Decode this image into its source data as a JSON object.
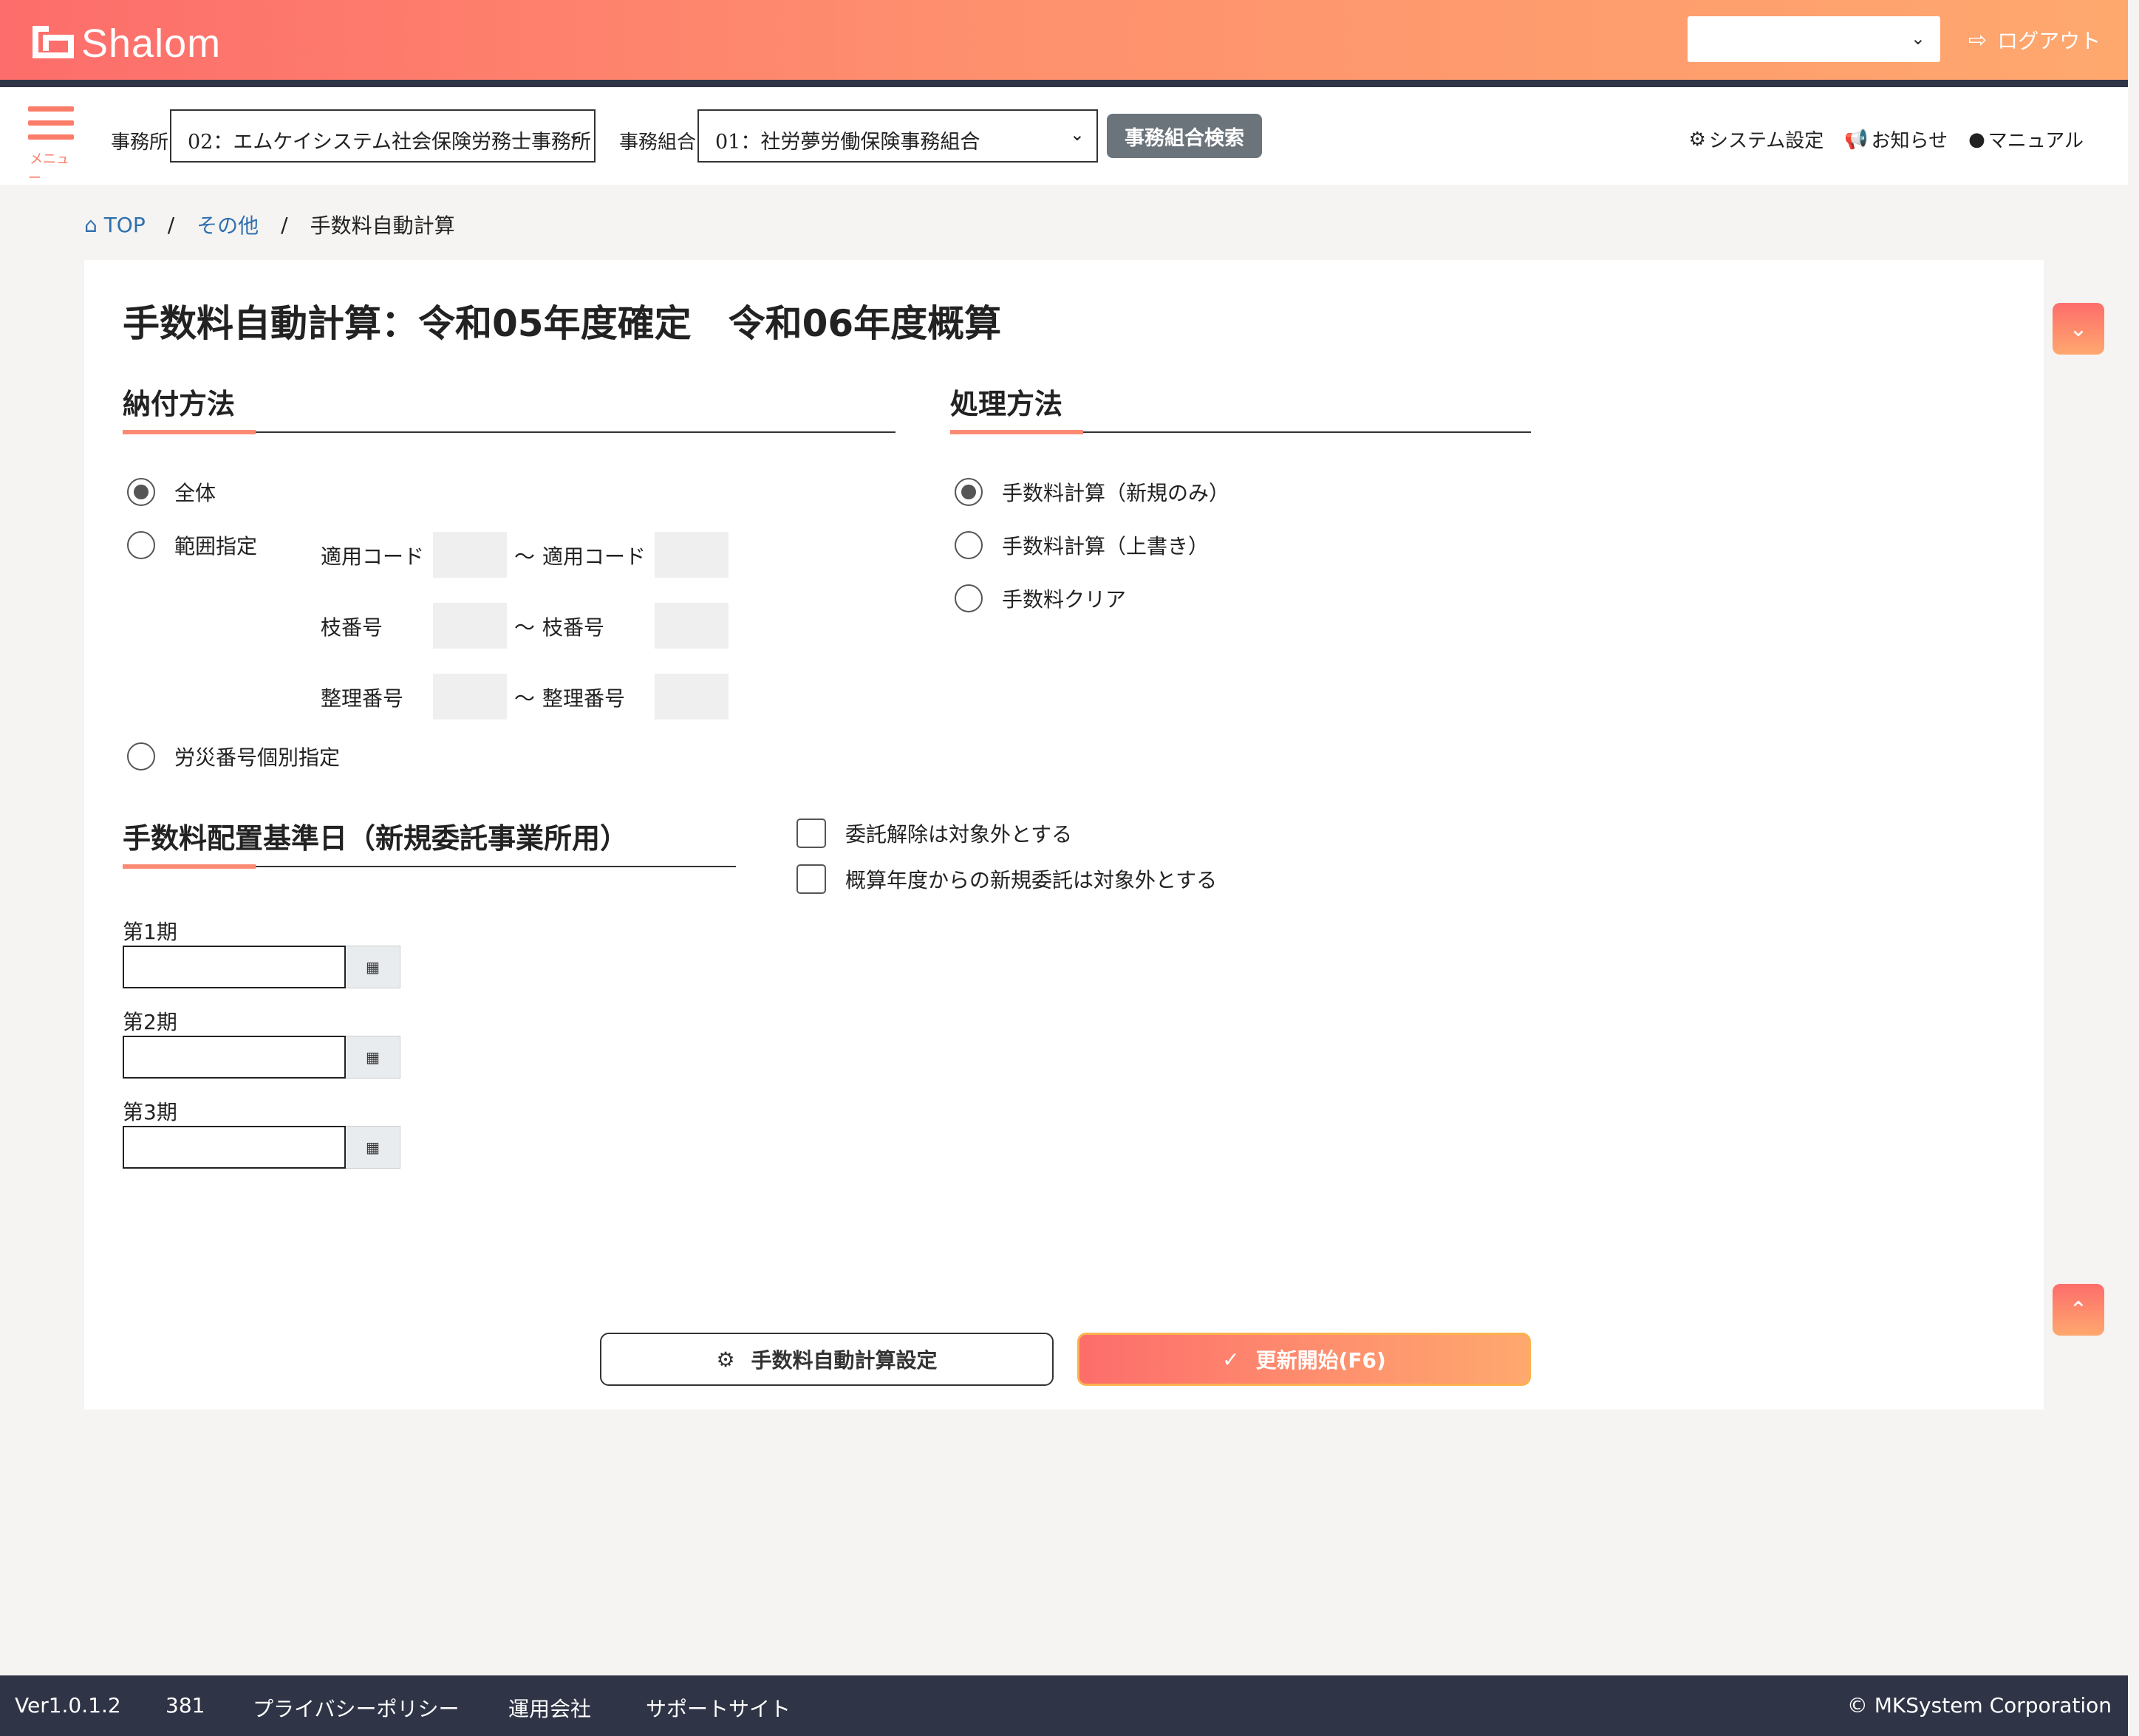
{
  "header": {
    "app_name": "Shalom",
    "top_select_value": "",
    "logout_label": "ログアウト"
  },
  "subheader": {
    "menu_label": "メニュー",
    "office_label": "事務所",
    "office_value": "02：エムケイシステム社会保険労務士事務所",
    "union_label": "事務組合",
    "union_value": "01：社労夢労働保険事務組合",
    "union_search_button": "事務組合検索",
    "links": {
      "system_settings": "システム設定",
      "notices": "お知らせ",
      "manual": "マニュアル"
    }
  },
  "breadcrumb": {
    "top": "TOP",
    "other": "その他",
    "current": "手数料自動計算"
  },
  "page": {
    "title": "手数料自動計算：令和05年度確定　令和06年度概算",
    "payment_method": {
      "heading": "納付方法",
      "options": [
        {
          "label": "全体",
          "selected": true
        },
        {
          "label": "範囲指定",
          "selected": false
        },
        {
          "label": "労災番号個別指定",
          "selected": false
        }
      ],
      "range_fields": {
        "apply_code": "適用コード",
        "branch_no": "枝番号",
        "ref_no": "整理番号",
        "tilde": "～"
      }
    },
    "processing_method": {
      "heading": "処理方法",
      "options": [
        {
          "label": "手数料計算（新規のみ）",
          "selected": true
        },
        {
          "label": "手数料計算（上書き）",
          "selected": false
        },
        {
          "label": "手数料クリア",
          "selected": false
        }
      ]
    },
    "base_date": {
      "heading": "手数料配置基準日（新規委託事業所用）",
      "periods": [
        {
          "label": "第1期",
          "value": ""
        },
        {
          "label": "第2期",
          "value": ""
        },
        {
          "label": "第3期",
          "value": ""
        }
      ]
    },
    "checkboxes": [
      {
        "label": "委託解除は対象外とする",
        "checked": false
      },
      {
        "label": "概算年度からの新規委託は対象外とする",
        "checked": false
      }
    ],
    "buttons": {
      "settings": "手数料自動計算設定",
      "update": "更新開始(F6)"
    }
  },
  "footer": {
    "version": "Ver1.0.1.2",
    "number": "381",
    "privacy": "プライバシーポリシー",
    "operator": "運用会社",
    "support": "サポートサイト",
    "copyright": "© MKSystem Corporation"
  },
  "colors": {
    "accent_start": "#fd6d6b",
    "accent_end": "#fea86e",
    "navy": "#2f3446",
    "link": "#2f6fae"
  }
}
